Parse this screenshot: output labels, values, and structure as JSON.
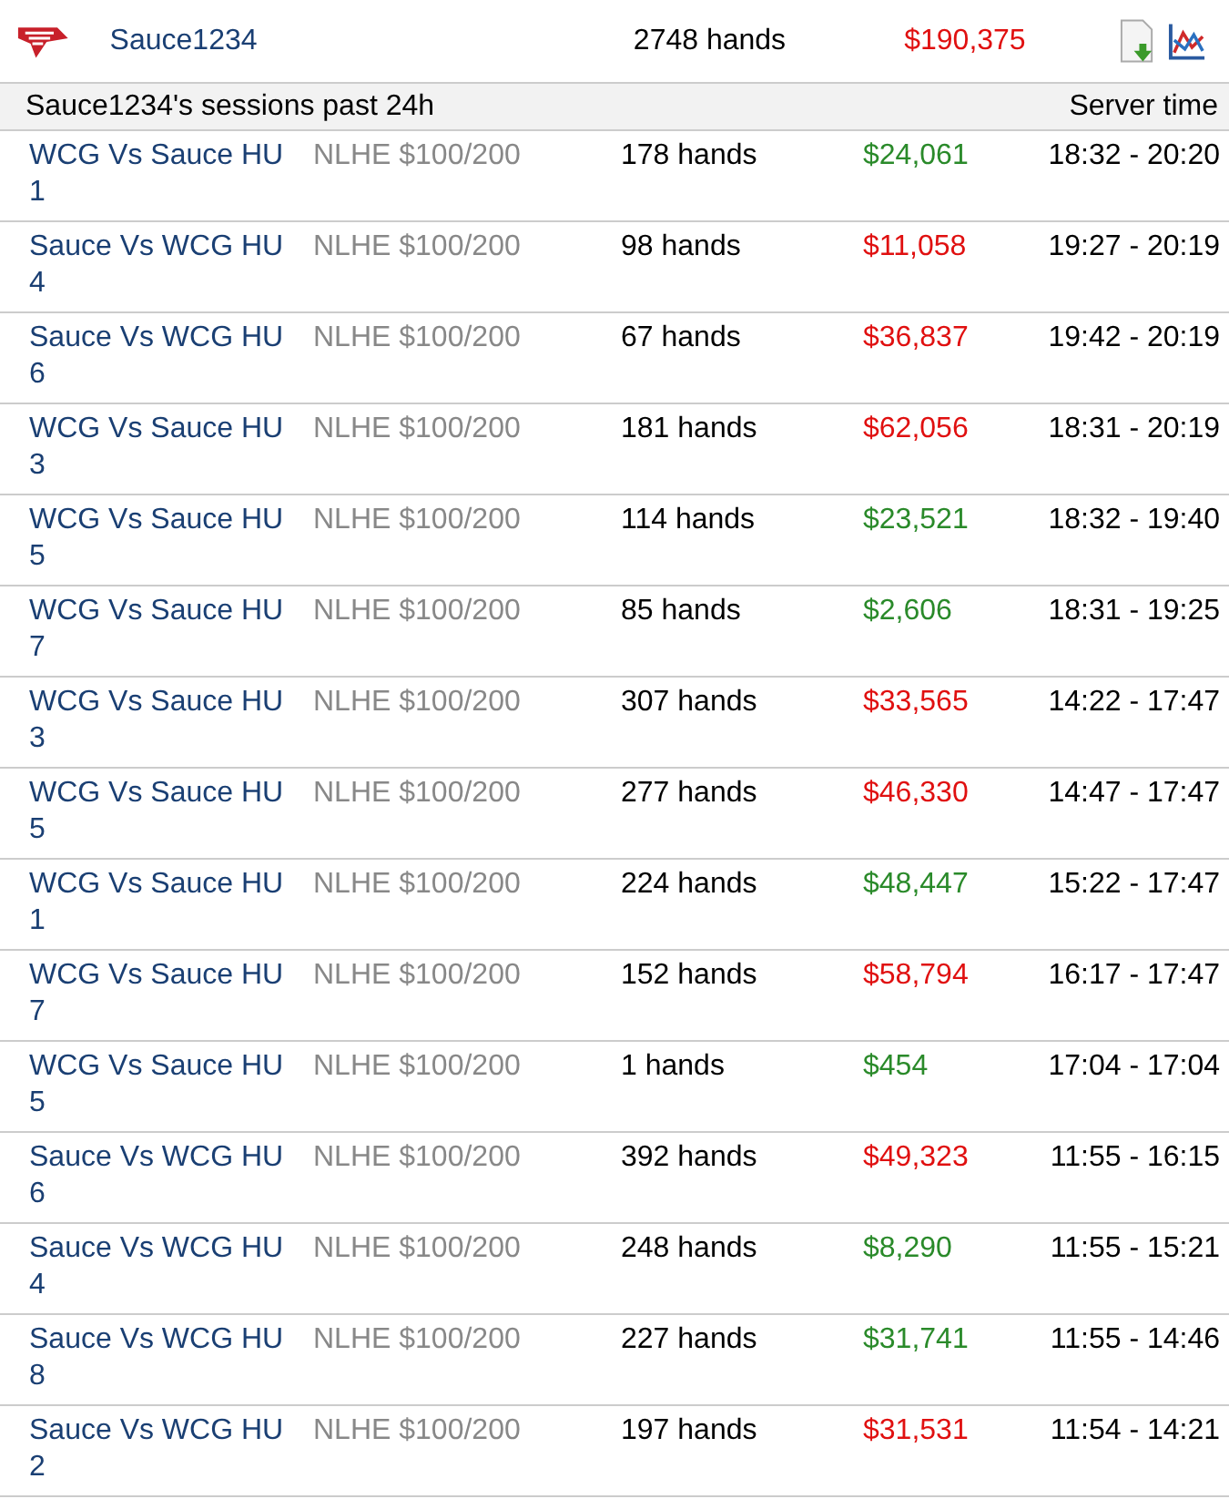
{
  "player": {
    "name": "Sauce1234",
    "hands": "2748 hands",
    "result": "$190,375",
    "color": "#e01010"
  },
  "sessions_header": {
    "title": "Sauce1234's sessions past 24h",
    "column_time": "Server time"
  },
  "sessions": [
    {
      "table": "WCG Vs Sauce HU 1",
      "stakes": "NLHE $100/200",
      "hands": "178 hands",
      "result": "$24,061",
      "color": "#2a8a2a",
      "time": "18:32 - 20:20"
    },
    {
      "table": "Sauce Vs WCG HU 4",
      "stakes": "NLHE $100/200",
      "hands": "98 hands",
      "result": "$11,058",
      "color": "#e01010",
      "time": "19:27 - 20:19"
    },
    {
      "table": "Sauce Vs WCG HU 6",
      "stakes": "NLHE $100/200",
      "hands": "67 hands",
      "result": "$36,837",
      "color": "#e01010",
      "time": "19:42 - 20:19"
    },
    {
      "table": "WCG Vs Sauce HU 3",
      "stakes": "NLHE $100/200",
      "hands": "181 hands",
      "result": "$62,056",
      "color": "#e01010",
      "time": "18:31 - 20:19"
    },
    {
      "table": "WCG Vs Sauce HU 5",
      "stakes": "NLHE $100/200",
      "hands": "114 hands",
      "result": "$23,521",
      "color": "#2a8a2a",
      "time": "18:32 - 19:40"
    },
    {
      "table": "WCG Vs Sauce HU 7",
      "stakes": "NLHE $100/200",
      "hands": "85 hands",
      "result": "$2,606",
      "color": "#2a8a2a",
      "time": "18:31 - 19:25"
    },
    {
      "table": "WCG Vs Sauce HU 3",
      "stakes": "NLHE $100/200",
      "hands": "307 hands",
      "result": "$33,565",
      "color": "#e01010",
      "time": "14:22 - 17:47"
    },
    {
      "table": "WCG Vs Sauce HU 5",
      "stakes": "NLHE $100/200",
      "hands": "277 hands",
      "result": "$46,330",
      "color": "#e01010",
      "time": "14:47 - 17:47"
    },
    {
      "table": "WCG Vs Sauce HU 1",
      "stakes": "NLHE $100/200",
      "hands": "224 hands",
      "result": "$48,447",
      "color": "#2a8a2a",
      "time": "15:22 - 17:47"
    },
    {
      "table": "WCG Vs Sauce HU 7",
      "stakes": "NLHE $100/200",
      "hands": "152 hands",
      "result": "$58,794",
      "color": "#e01010",
      "time": "16:17 - 17:47"
    },
    {
      "table": "WCG Vs Sauce HU 5",
      "stakes": "NLHE $100/200",
      "hands": "1 hands",
      "result": "$454",
      "color": "#2a8a2a",
      "time": "17:04 - 17:04"
    },
    {
      "table": "Sauce Vs WCG HU 6",
      "stakes": "NLHE $100/200",
      "hands": "392 hands",
      "result": "$49,323",
      "color": "#e01010",
      "time": "11:55 - 16:15"
    },
    {
      "table": "Sauce Vs WCG HU 4",
      "stakes": "NLHE $100/200",
      "hands": "248 hands",
      "result": "$8,290",
      "color": "#2a8a2a",
      "time": "11:55 - 15:21"
    },
    {
      "table": "Sauce Vs WCG HU 8",
      "stakes": "NLHE $100/200",
      "hands": "227 hands",
      "result": "$31,741",
      "color": "#2a8a2a",
      "time": "11:55 - 14:46"
    },
    {
      "table": "Sauce Vs WCG HU 2",
      "stakes": "NLHE $100/200",
      "hands": "197 hands",
      "result": "$31,531",
      "color": "#e01010",
      "time": "11:54 - 14:21"
    }
  ]
}
